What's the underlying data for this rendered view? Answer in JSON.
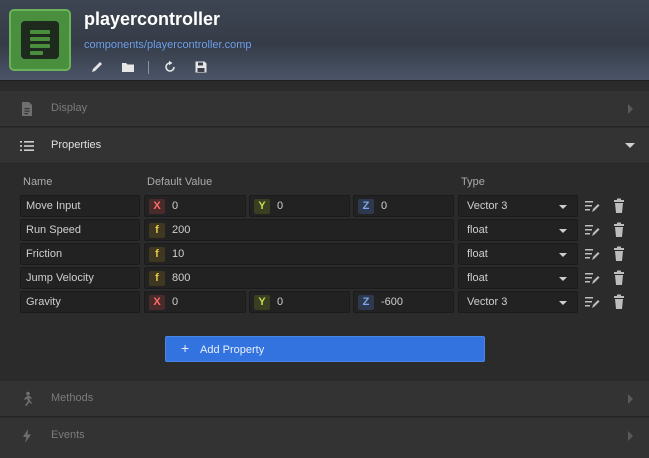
{
  "header": {
    "title": "playercontroller",
    "path": "components/playercontroller.comp",
    "tools": [
      "edit-icon",
      "folder-icon",
      "reload-icon",
      "save-icon"
    ]
  },
  "sections": {
    "display": {
      "label": "Display",
      "icon": "document-icon",
      "state": "collapsed"
    },
    "properties": {
      "label": "Properties",
      "icon": "list-icon",
      "state": "expanded"
    },
    "methods": {
      "label": "Methods",
      "icon": "running-figure-icon",
      "state": "collapsed"
    },
    "events": {
      "label": "Events",
      "icon": "lightning-icon",
      "state": "collapsed"
    }
  },
  "properties": {
    "columns": {
      "name": "Name",
      "default": "Default Value",
      "type": "Type"
    },
    "rows": [
      {
        "name": "Move Input",
        "kind": "vec3",
        "x": "0",
        "y": "0",
        "z": "0",
        "type": "Vector 3"
      },
      {
        "name": "Run Speed",
        "kind": "float",
        "f": "200",
        "type": "float"
      },
      {
        "name": "Friction",
        "kind": "float",
        "f": "10",
        "type": "float"
      },
      {
        "name": "Jump Velocity",
        "kind": "float",
        "f": "800",
        "type": "float"
      },
      {
        "name": "Gravity",
        "kind": "vec3",
        "x": "0",
        "y": "0",
        "z": "-600",
        "type": "Vector 3"
      }
    ],
    "badges": {
      "x": "X",
      "y": "Y",
      "z": "Z",
      "f": "f"
    },
    "add_button": {
      "plus": "+",
      "label": "Add Property"
    }
  },
  "colors": {
    "accent": "#3273df",
    "logo_green": "#4a8f3e",
    "path_link": "#6d9ee8",
    "badge_x": "#ff6b6b",
    "badge_y": "#c8d94a",
    "badge_z": "#7ba6e8",
    "badge_f": "#e6c84a"
  }
}
